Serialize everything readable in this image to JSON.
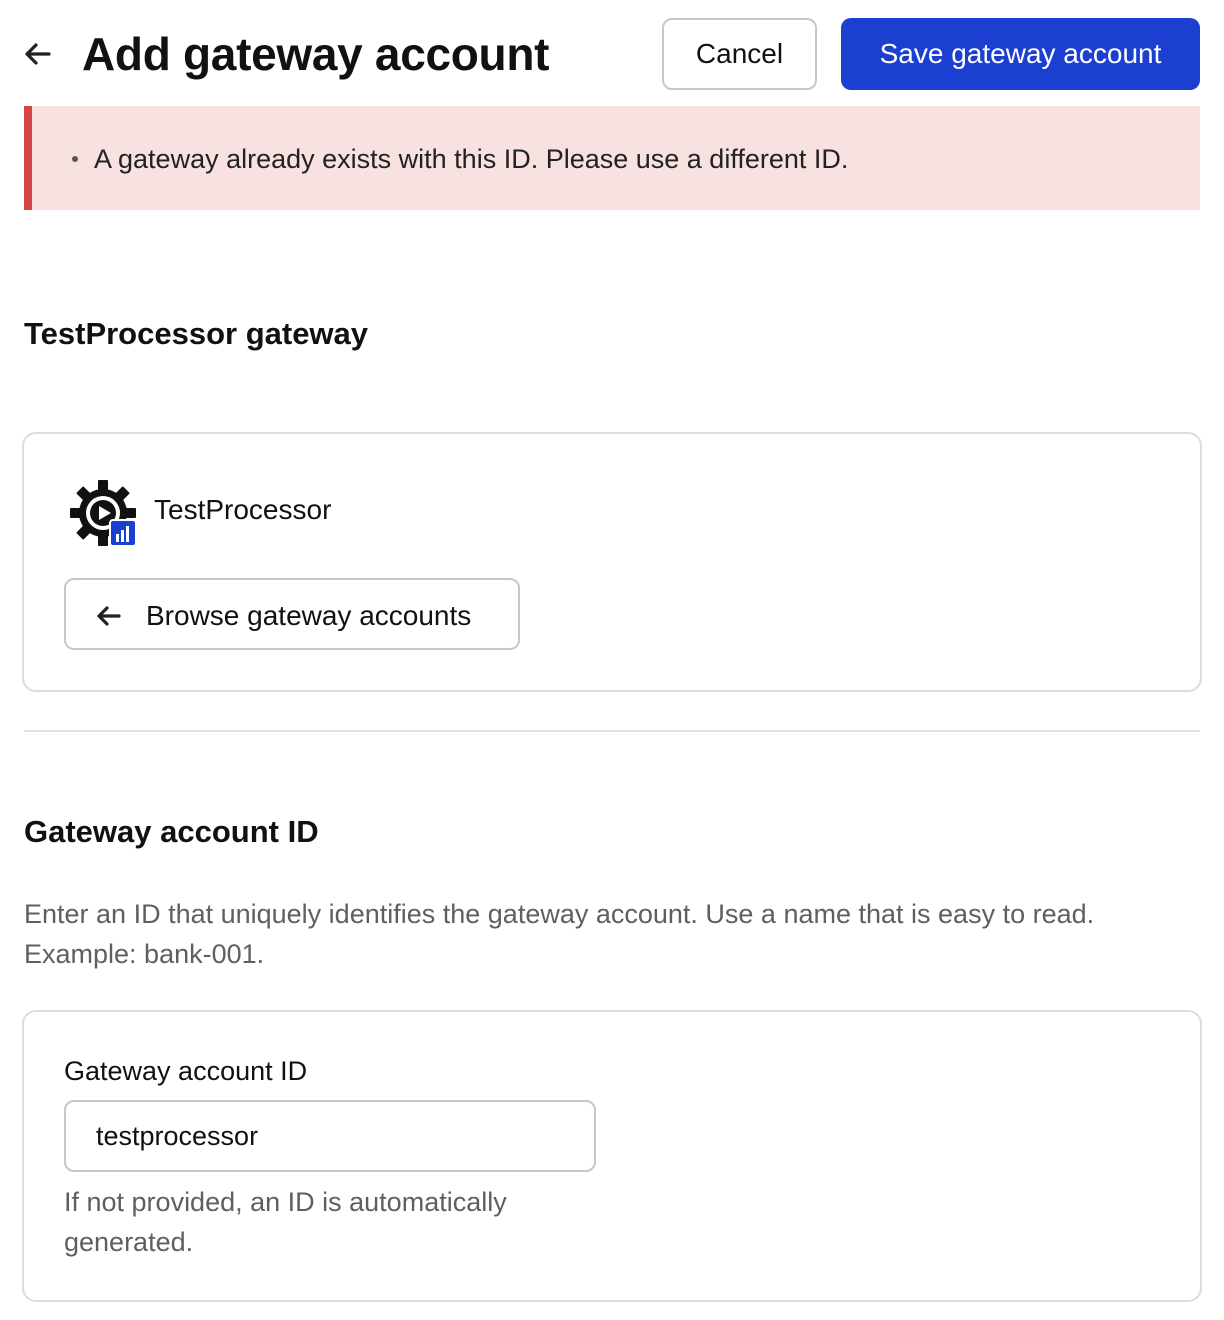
{
  "header": {
    "title": "Add gateway account",
    "cancel_label": "Cancel",
    "save_label": "Save gateway account"
  },
  "error_banner": {
    "messages": [
      "A gateway already exists with this ID. Please use a different ID."
    ]
  },
  "processor_section": {
    "title": "TestProcessor gateway",
    "processor_name": "TestProcessor",
    "browse_label": "Browse gateway accounts"
  },
  "id_section": {
    "title": "Gateway account ID",
    "description": "Enter an ID that uniquely identifies the gateway account. Use a name that is easy to read. Example: bank-001.",
    "field_label": "Gateway account ID",
    "field_value": "testprocessor",
    "field_hint": "If not provided, an ID is automatically generated."
  },
  "icons": {
    "back": "arrow-left-icon",
    "browse": "arrow-left-icon",
    "processor_logo": "gear-play-icon"
  },
  "colors": {
    "primary": "#1b3fd1",
    "error_background": "#f8e1e1",
    "error_accent": "#d64545"
  }
}
